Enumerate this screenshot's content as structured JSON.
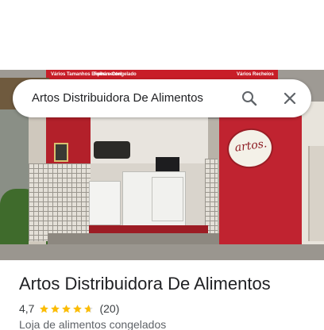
{
  "search": {
    "query": "Artos Distribuidora De Alimentos"
  },
  "photo": {
    "banner_texts": [
      "Vários Tamanhos Experimente!",
      "Folha e Congelado",
      "Vários Recheios"
    ],
    "storefront_logo": "artos."
  },
  "place": {
    "name": "Artos Distribuidora De Alimentos",
    "rating": "4,7",
    "rating_stars_fraction": 0.94,
    "review_count": "(20)",
    "category": "Loja de alimentos congelados"
  },
  "colors": {
    "star": "#fbbc04",
    "star_empty": "#dadce0",
    "icon": "#5f6368",
    "title_text": "#202124"
  }
}
